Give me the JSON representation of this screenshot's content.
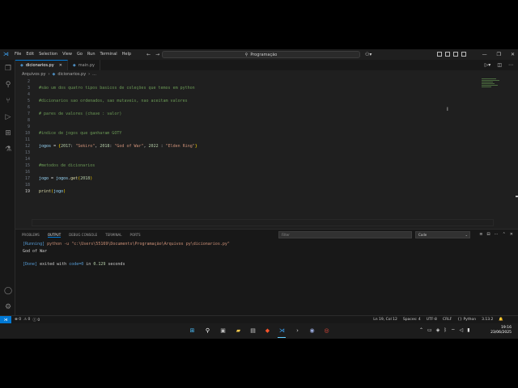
{
  "window": {
    "menu": [
      "File",
      "Edit",
      "Selection",
      "View",
      "Go",
      "Run",
      "Terminal",
      "Help"
    ],
    "search_text": "Programação",
    "controls": [
      "—",
      "❐",
      "✕"
    ]
  },
  "tabs": [
    {
      "label": "dicionarios.py",
      "active": true
    },
    {
      "label": "main.py",
      "active": false
    }
  ],
  "breadcrumb": [
    "Arquivos py",
    "dicionarios.py",
    "..."
  ],
  "editor": {
    "line_numbers": [
      "2",
      "3",
      "4",
      "5",
      "6",
      "7",
      "8",
      "9",
      "10",
      "11",
      "12",
      "13",
      "14",
      "15",
      "16",
      "17",
      "18",
      "19"
    ],
    "current_line": "19",
    "lines": {
      "l3": "#são um dos quatro tipos basicos de coleções que temos em python",
      "l5": "#dicionarios sao ordenados, sao mutaveis, nao aceitam valores",
      "l7": "# pares de valores (chave : valor)",
      "l10": "#indice de jogos que ganharam GOTY",
      "l12_var": "jogos",
      "l12_eq": " = ",
      "l12_open": "{",
      "l12_k1": "2017",
      "l12_c1": ": ",
      "l12_v1": "\"Sekiro\"",
      "l12_s1": ", ",
      "l12_k2": "2018",
      "l12_c2": ": ",
      "l12_v2": "\"God of War\"",
      "l12_s2": ", ",
      "l12_k3": "2022",
      "l12_c3": " : ",
      "l12_v3": "\"Elden Ring\"",
      "l12_close": "}",
      "l15": "#metodos de dicionarios",
      "l17_var": "jogo",
      "l17_eq": " = ",
      "l17_obj": "jogos",
      "l17_dot": ".",
      "l17_fn": "get",
      "l17_open": "(",
      "l17_arg": "2018",
      "l17_close": ")",
      "l19_fn": "print",
      "l19_open": "(",
      "l19_arg": "jogo",
      "l19_close": ")"
    }
  },
  "panel": {
    "tabs": [
      "PROBLEMS",
      "OUTPUT",
      "DEBUG CONSOLE",
      "TERMINAL",
      "PORTS"
    ],
    "active_tab": "OUTPUT",
    "filter_placeholder": "Filter",
    "dropdown_value": "Code",
    "output": {
      "run_tag": "[Running]",
      "run_cmd": " python -u \"c:\\Users\\55169\\Documents\\Programação\\Arquivos py\\dicionarios.py\"",
      "result": "God of War",
      "done_tag": "[Done]",
      "done_text": " exited with ",
      "done_code": "code=0",
      "done_in": " in ",
      "done_secs": "0.129",
      "done_unit": " seconds"
    }
  },
  "statusbar": {
    "errors": "⊗ 0",
    "warnings": "⚠ 0",
    "info": "ⓘ 0",
    "position": "Ln 19, Col 12",
    "spaces": "Spaces: 4",
    "encoding": "UTF-8",
    "eol": "CRLF",
    "language": "{} Python",
    "version": "3.13.2"
  },
  "taskbar": {
    "time": "19:16",
    "date": "23/06/2025"
  },
  "colors": {
    "accent": "#0078d4",
    "comment": "#6a9955",
    "string": "#ce9178",
    "number": "#b5cea8"
  }
}
